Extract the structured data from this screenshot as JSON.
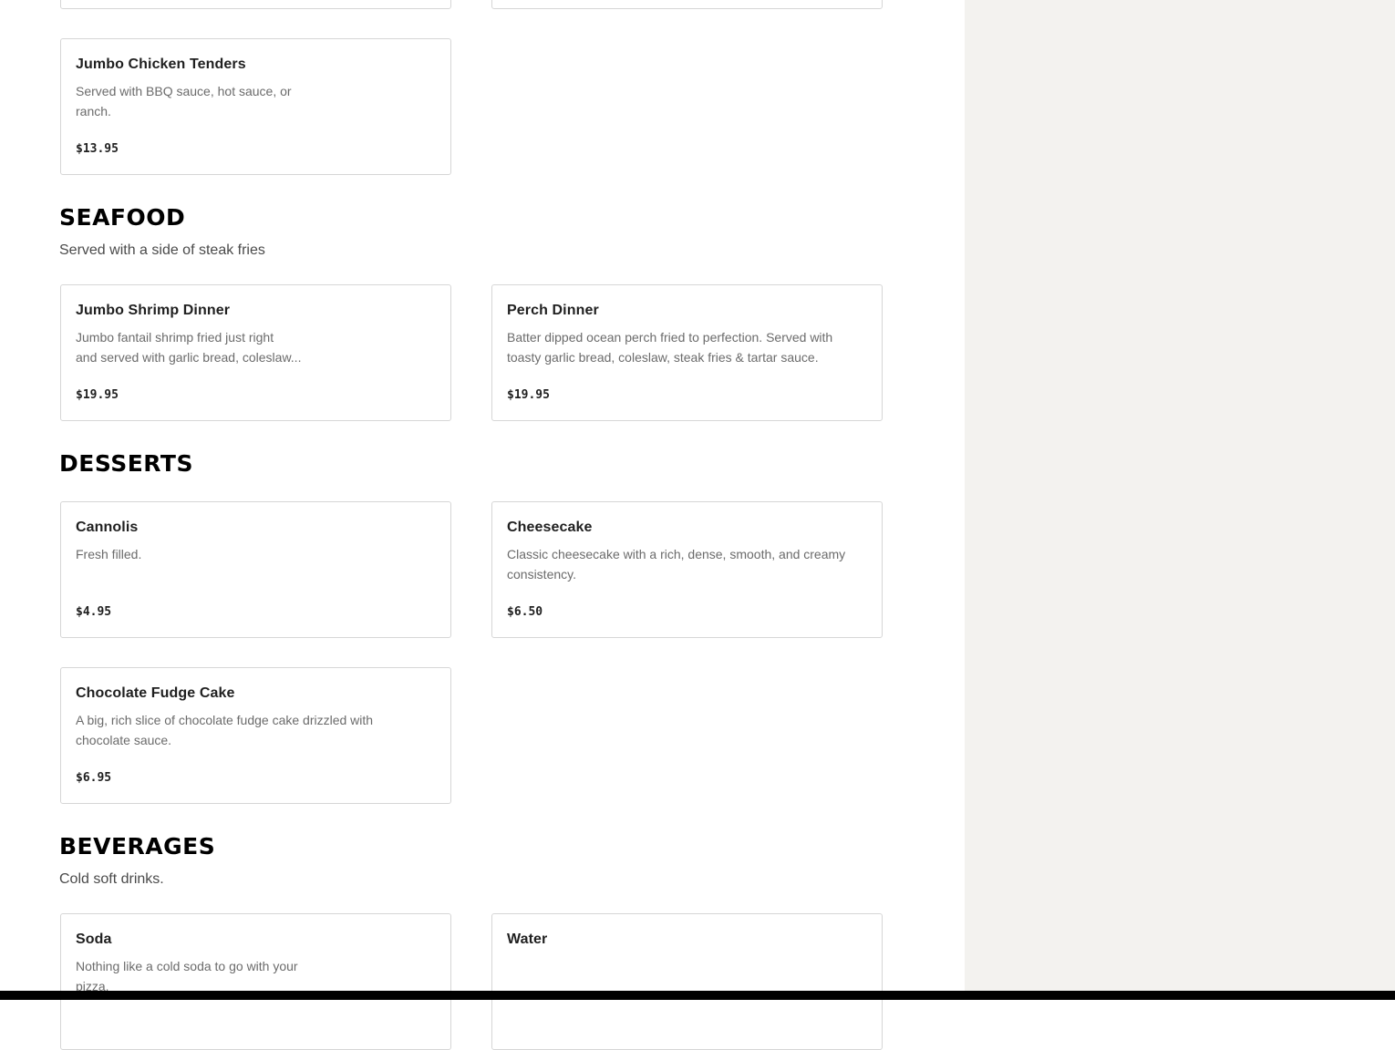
{
  "sections": {
    "entrees": {
      "items": [
        {
          "name": "Jumbo Chicken Tenders",
          "desc_lines": [
            "Served with BBQ sauce, hot sauce, or",
            "ranch."
          ],
          "price": "$13.95"
        }
      ]
    },
    "seafood": {
      "title": "SEAFOOD",
      "subtitle": "Served with a side of steak fries",
      "items": [
        {
          "name": "Jumbo Shrimp Dinner",
          "desc_lines": [
            "Jumbo fantail shrimp fried just right",
            "and served with garlic bread, coleslaw..."
          ],
          "price": "$19.95"
        },
        {
          "name": "Perch Dinner",
          "desc_lines": [
            "Batter dipped ocean perch fried to perfection. Served with",
            "toasty garlic bread, coleslaw, steak fries & tartar sauce."
          ],
          "price": "$19.95"
        }
      ]
    },
    "desserts": {
      "title": "DESSERTS",
      "items": [
        {
          "name": "Cannolis",
          "desc_lines": [
            "Fresh filled.",
            ""
          ],
          "price": "$4.95"
        },
        {
          "name": "Cheesecake",
          "desc_lines": [
            "Classic cheesecake with a rich, dense, smooth, and creamy",
            "consistency."
          ],
          "price": "$6.50"
        },
        {
          "name": "Chocolate Fudge Cake",
          "desc_lines": [
            "A big, rich slice of chocolate fudge cake drizzled with",
            "chocolate sauce."
          ],
          "price": "$6.95"
        }
      ]
    },
    "beverages": {
      "title": "BEVERAGES",
      "subtitle": "Cold soft drinks.",
      "items": [
        {
          "name": "Soda",
          "desc_lines": [
            "Nothing like a cold soda to go with your",
            "pizza."
          ]
        },
        {
          "name": "Water"
        }
      ]
    }
  },
  "colors": {
    "background": "#ffffff",
    "sidebar": "#f3f2ef",
    "card_border": "#d6d6d6",
    "description": "#6b6b6b",
    "heading": "#000000"
  }
}
